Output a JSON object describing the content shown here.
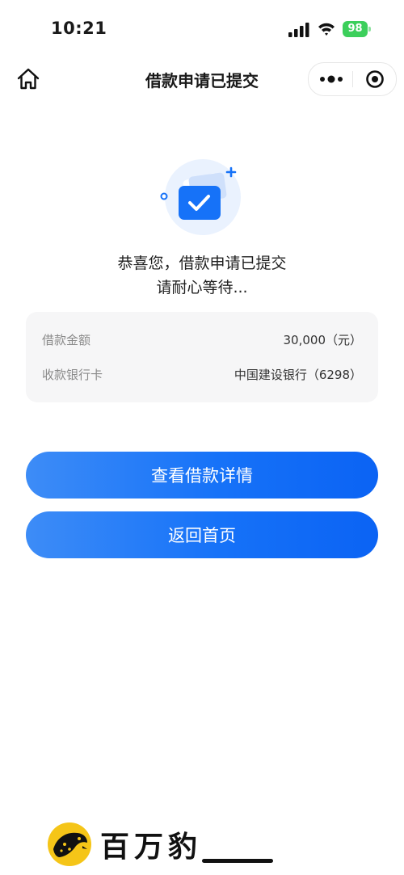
{
  "status_bar": {
    "time": "10:21",
    "battery": "98"
  },
  "nav": {
    "title": "借款申请已提交"
  },
  "result": {
    "message_line1": "恭喜您，借款申请已提交",
    "message_line2": "请耐心等待..."
  },
  "info": {
    "rows": [
      {
        "label": "借款金额",
        "value": "30,000（元）"
      },
      {
        "label": "收款银行卡",
        "value": "中国建设银行（6298）"
      }
    ]
  },
  "buttons": {
    "detail": "查看借款详情",
    "home": "返回首页"
  },
  "brand": {
    "name": "百万豹"
  },
  "colors": {
    "primary": "#1672f8",
    "card_bg": "#f6f6f7",
    "battery": "#3ccf5b"
  }
}
